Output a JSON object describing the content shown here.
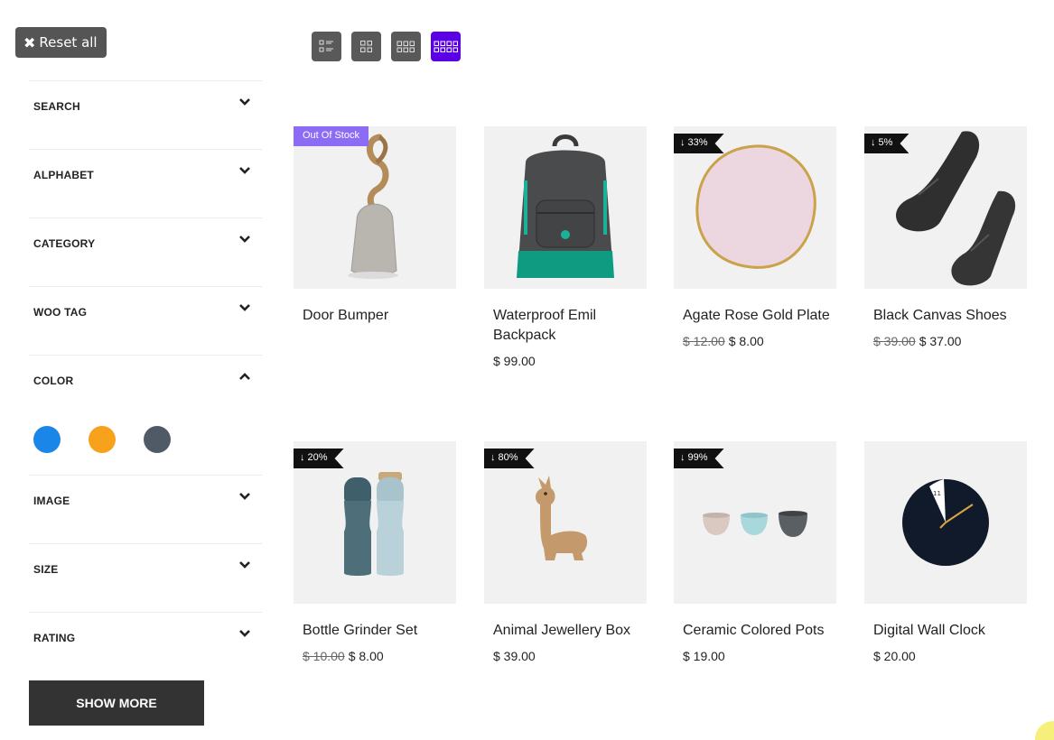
{
  "reset": {
    "icon": "close-icon",
    "label": "Reset all"
  },
  "view_toggles": [
    {
      "name": "list-view",
      "active": false
    },
    {
      "name": "grid-2",
      "active": false
    },
    {
      "name": "grid-3",
      "active": false
    },
    {
      "name": "grid-4",
      "active": true
    }
  ],
  "filters": [
    {
      "label": "SEARCH",
      "open": false
    },
    {
      "label": "ALPHABET",
      "open": false
    },
    {
      "label": "CATEGORY",
      "open": false
    },
    {
      "label": "WOO TAG",
      "open": false
    },
    {
      "label": "COLOR",
      "open": true
    },
    {
      "label": "IMAGE",
      "open": false
    },
    {
      "label": "SIZE",
      "open": false
    },
    {
      "label": "RATING",
      "open": false
    }
  ],
  "color_swatches": [
    "#1a86e8",
    "#f7a11d",
    "#505a66"
  ],
  "show_more": "SHOW MORE",
  "colors": {
    "accent": "#5b00e6",
    "out_of_stock_badge": "#8c6cf5",
    "discount_badge": "#111111"
  },
  "products": [
    {
      "name": "Door Bumper",
      "badge": "Out Of Stock",
      "badge_type": "oos",
      "old_price": "",
      "price": "",
      "image": "door-bumper"
    },
    {
      "name": "Waterproof Emil Backpack",
      "badge": "",
      "badge_type": "",
      "old_price": "",
      "price": "$ 99.00",
      "image": "backpack"
    },
    {
      "name": "Agate Rose Gold Plate",
      "badge": "↓ 33%",
      "badge_type": "disc",
      "old_price": "$ 12.00",
      "price": "$ 8.00",
      "image": "plate"
    },
    {
      "name": "Black Canvas Shoes",
      "badge": "↓ 5%",
      "badge_type": "disc",
      "old_price": "$ 39.00",
      "price": "$ 37.00",
      "image": "shoes"
    },
    {
      "name": "Bottle Grinder Set",
      "badge": "↓ 20%",
      "badge_type": "disc",
      "old_price": "$ 10.00",
      "price": "$ 8.00",
      "image": "grinders"
    },
    {
      "name": "Animal Jewellery Box",
      "badge": "↓ 80%",
      "badge_type": "disc",
      "old_price": "",
      "price": "$ 39.00",
      "image": "llama"
    },
    {
      "name": "Ceramic Colored Pots",
      "badge": "↓ 99%",
      "badge_type": "disc",
      "old_price": "",
      "price": "$ 19.00",
      "image": "pots"
    },
    {
      "name": "Digital Wall Clock",
      "badge": "",
      "badge_type": "",
      "old_price": "",
      "price": "$ 20.00",
      "image": "clock",
      "clock_number": "11"
    }
  ]
}
